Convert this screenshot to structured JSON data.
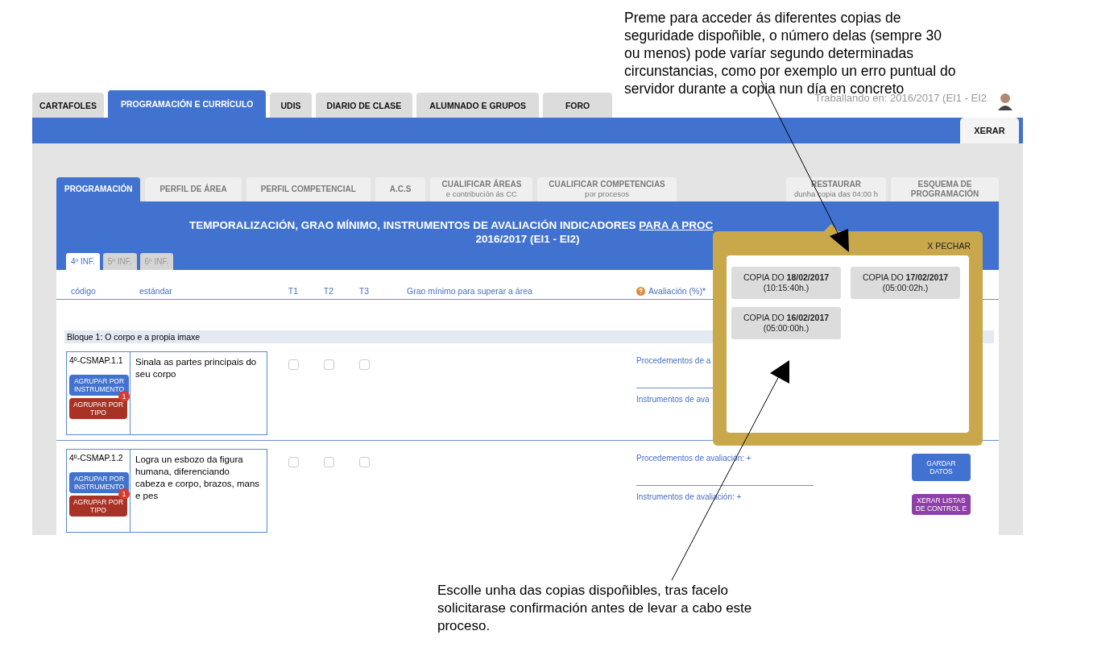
{
  "top_note": "Preme para acceder ás diferentes copias de seguridade dispoñible, o número delas (sempre 30 ou menos) pode varíar segundo determinadas circunstancias, como por exemplo un erro puntual do servidor durante a copia nun día en concreto",
  "header": {
    "working_on": "Traballando en: 2016/2017 (EI1 - EI2",
    "tabs": [
      {
        "label": "CARTAFOLES",
        "selected": false
      },
      {
        "label": "PROGRAMACIÓN E CURRÍCULO",
        "selected": true
      },
      {
        "label": "UDIS",
        "selected": false
      },
      {
        "label": "DIARIO DE CLASE",
        "selected": false
      },
      {
        "label": "ALUMNADO E GRUPOS",
        "selected": false
      },
      {
        "label": "FORO",
        "selected": false
      }
    ]
  },
  "toolbar": {
    "button": "XERAR"
  },
  "subnav": {
    "tabs": [
      {
        "label": "PROGRAMACIÓN",
        "selected": true
      },
      {
        "label": "PERFIL DE ÁREA",
        "selected": false
      },
      {
        "label": "PERFIL COMPETENCIAL",
        "selected": false
      },
      {
        "label": "A.C.S",
        "selected": false
      },
      {
        "label": "CUALIFICAR ÁREAS",
        "sublabel": "e contribución ás CC",
        "selected": false
      },
      {
        "label": "CUALIFICAR COMPETENCIAS",
        "sublabel": "por procesos",
        "selected": false
      }
    ],
    "actions": [
      {
        "label": "RESTAURAR",
        "sublabel": "dunha copia das 04:00 h"
      },
      {
        "label": "ESQUEMA DE PROGRAMACIÓN"
      }
    ]
  },
  "panel": {
    "title": "TEMPORALIZACIÓN, GRAO MÍNIMO, INSTRUMENTOS DE AVALIACIÓN INDICADORES",
    "title_link": "PARA A PROC",
    "subtitle": "2016/2017 (EI1 - EI2)",
    "levels": [
      {
        "label": "4º INF.",
        "selected": true
      },
      {
        "label": "5º INF.",
        "selected": false
      },
      {
        "label": "6º INF.",
        "selected": false
      }
    ]
  },
  "table": {
    "columns": [
      "código",
      "estándar",
      "T1",
      "T2",
      "T3",
      "Grao mínimo para superar a área",
      "Avaliación (%)*"
    ],
    "block": "Bloque 1: O corpo e a propia imaxe",
    "rows": [
      {
        "code": "4º-CSMAP.1.1",
        "group_instrument": "AGRUPAR POR INSTRUMENTO",
        "group_type": "AGRUPAR POR TIPO",
        "badge": "1",
        "standard": "Sinala as partes principais do seu corpo",
        "terms": [
          {
            "checked": false
          },
          {
            "checked": false
          },
          {
            "checked": false
          }
        ],
        "procedures": "Procedementos de a",
        "instruments": "Instrumentos de ava"
      },
      {
        "code": "4º-CSMAP.1.2",
        "group_instrument": "AGRUPAR POR INSTRUMENTO",
        "group_type": "AGRUPAR POR TIPO",
        "badge": "1",
        "standard": "Logra un esbozo da figura humana, diferenciando cabeza e corpo, brazos, mans e pes",
        "terms": [
          {
            "checked": false
          },
          {
            "checked": false
          },
          {
            "checked": false
          }
        ],
        "procedures": "Procedementos de avaliación: +",
        "instruments": "Instrumentos de avaliación: +",
        "actions": [
          {
            "label": "GARDAR DATOS",
            "kind": "save"
          },
          {
            "label": "XERAR LISTAS DE CONTROL E",
            "kind": "generate"
          }
        ]
      }
    ]
  },
  "backup_popup": {
    "close": "X PECHAR",
    "copies": [
      {
        "label": "COPIA DO **18/02/2017**",
        "time": "(10:15:40h.)"
      },
      {
        "label": "COPIA DO **17/02/2017**",
        "time": "(05:00:02h.)"
      },
      {
        "label": "COPIA DO **16/02/2017**",
        "time": "(05:00:00h.)"
      }
    ]
  },
  "bottom_note": "Escolle unha das copias dispoñibles, tras facelo solicitarase confirmación antes de levar a cabo este proceso."
}
